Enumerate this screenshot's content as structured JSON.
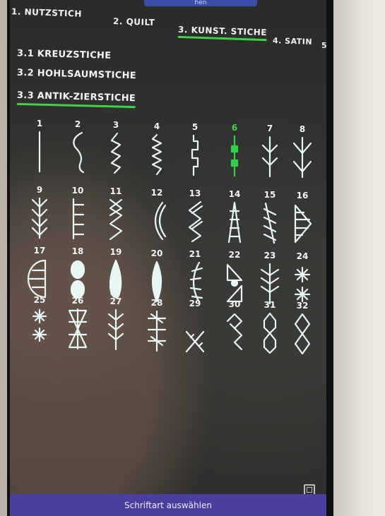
{
  "header": {
    "title_fragment": "hen"
  },
  "tabs": [
    {
      "label": "1. NUTZSTICH"
    },
    {
      "label": "2. QUILT"
    },
    {
      "label": "3. KUNST. STICHE"
    },
    {
      "label": "4. SATIN"
    },
    {
      "label": "5"
    }
  ],
  "categories": [
    {
      "label": "3.1 KREUZSTICHE"
    },
    {
      "label": "3.2 HOHLSAUMSTICHE"
    },
    {
      "label": "3.3 ANTIK-ZIERSTICHE"
    }
  ],
  "stitches": [
    {
      "number": "1",
      "icon": "straight-stitch-icon"
    },
    {
      "number": "2",
      "icon": "s-curve-stitch-icon"
    },
    {
      "number": "3",
      "icon": "triple-zigzag-stitch-icon"
    },
    {
      "number": "4",
      "icon": "serpentine-stitch-icon"
    },
    {
      "number": "5",
      "icon": "step-stitch-icon"
    },
    {
      "number": "6",
      "icon": "bead-stitch-icon"
    },
    {
      "number": "7",
      "icon": "feather-arrow-stitch-icon"
    },
    {
      "number": "8",
      "icon": "arrow-stitch-icon"
    },
    {
      "number": "9",
      "icon": "double-arrow-stitch-icon"
    },
    {
      "number": "10",
      "icon": "comb-stitch-icon"
    },
    {
      "number": "11",
      "icon": "chevron-stitch-icon"
    },
    {
      "number": "12",
      "icon": "crescent-stitch-icon"
    },
    {
      "number": "13",
      "icon": "zigzag-satin-stitch-icon"
    },
    {
      "number": "14",
      "icon": "ladder-arrow-stitch-icon"
    },
    {
      "number": "15",
      "icon": "diagonal-satin-stitch-icon"
    },
    {
      "number": "16",
      "icon": "triangle-fill-stitch-icon"
    },
    {
      "number": "17",
      "icon": "half-circle-stitch-icon"
    },
    {
      "number": "18",
      "icon": "oval-bead-stitch-icon"
    },
    {
      "number": "19",
      "icon": "teardrop-stitch-icon"
    },
    {
      "number": "20",
      "icon": "leaf-stitch-icon"
    },
    {
      "number": "21",
      "icon": "fern-stitch-icon"
    },
    {
      "number": "22",
      "icon": "bow-stitch-icon"
    },
    {
      "number": "23",
      "icon": "wheat-stitch-icon"
    },
    {
      "number": "24",
      "icon": "star-stitch-icon"
    },
    {
      "number": "25",
      "icon": "snowflake-stitch-icon"
    },
    {
      "number": "26",
      "icon": "lattice-stitch-icon"
    },
    {
      "number": "27",
      "icon": "branch-stitch-icon"
    },
    {
      "number": "28",
      "icon": "cross-branch-stitch-icon"
    },
    {
      "number": "29",
      "icon": "corner-fringe-stitch-icon"
    },
    {
      "number": "30",
      "icon": "corner-zigzag-stitch-icon"
    },
    {
      "number": "31",
      "icon": "hexagon-chain-stitch-icon"
    },
    {
      "number": "32",
      "icon": "diamond-chain-stitch-icon"
    }
  ],
  "selected_stitch": "6",
  "colors": {
    "accent": "#3fd14a",
    "stitch": "#e9f7f4",
    "footer": "#4a3f9e"
  },
  "footer": {
    "label": "Schriftart auswählen"
  }
}
